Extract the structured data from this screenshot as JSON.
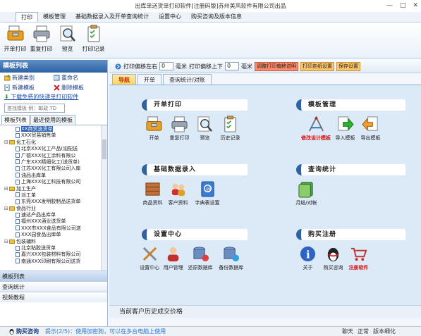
{
  "window": {
    "title": "出库单送货单打印软件[注册码版]苏州美风软件有限公司出品",
    "controls": [
      "—",
      "□",
      "✕"
    ]
  },
  "menu": {
    "tabs": [
      "打印",
      "模板管理",
      "基础数据录入及开单查询统计",
      "设置中心",
      "购买咨询及版本信息"
    ],
    "active": 0
  },
  "ribbon": {
    "buttons": [
      {
        "label": "开单打印",
        "icon": "print-toolbox-icon"
      },
      {
        "label": "重复打印",
        "icon": "printer-icon"
      },
      {
        "label": "预览",
        "icon": "magnifier-icon"
      },
      {
        "label": "打印记录",
        "icon": "clipboard-icon"
      }
    ]
  },
  "left_panel": {
    "title": "模板列表",
    "actions": [
      {
        "label": "新建类别",
        "icon": "add-category-icon"
      },
      {
        "label": "重命名",
        "icon": "rename-icon"
      },
      {
        "label": "新建模板",
        "icon": "new-template-icon"
      },
      {
        "label": "删除模板",
        "icon": "delete-icon"
      }
    ],
    "download_link": "下载免费的快递单打印软件",
    "search_placeholder": "查找模板 例：邮政 TD",
    "tabs": [
      "模板列表",
      "最近使用的模板"
    ],
    "tree": [
      {
        "level": 2,
        "type": "doc",
        "text": "XX商贸送货单",
        "selected": true
      },
      {
        "level": 2,
        "type": "doc",
        "text": "XXX贸易销售单"
      },
      {
        "level": 1,
        "type": "folder",
        "text": "化工石化",
        "toggle": "⊟"
      },
      {
        "level": 2,
        "type": "doc",
        "text": "北京XXX化工产品(油配送"
      },
      {
        "level": 2,
        "type": "doc",
        "text": "广德XXX化工涂料有限公"
      },
      {
        "level": 2,
        "type": "doc",
        "text": "广东XXX精细化工(送货单)"
      },
      {
        "level": 2,
        "type": "doc",
        "text": "江苏XXX化工有限公司入库"
      },
      {
        "level": 2,
        "type": "doc",
        "text": "油品出库单"
      },
      {
        "level": 2,
        "type": "doc",
        "text": "上海XXX化工科技有限公司"
      },
      {
        "level": 1,
        "type": "folder",
        "text": "加工生产",
        "toggle": "⊟"
      },
      {
        "level": 2,
        "type": "doc",
        "text": "派工单"
      },
      {
        "level": 2,
        "type": "doc",
        "text": "东莞XXX发明胶制品送货单"
      },
      {
        "level": 1,
        "type": "folder",
        "text": "食品行业",
        "toggle": "⊟"
      },
      {
        "level": 2,
        "type": "doc",
        "text": "速达产品出库单"
      },
      {
        "level": 2,
        "type": "doc",
        "text": "福州XXX酒业送货单"
      },
      {
        "level": 2,
        "type": "doc",
        "text": "XXX市XXX食品有限公司送"
      },
      {
        "level": 2,
        "type": "doc",
        "text": "XXX园食品出库单"
      },
      {
        "level": 1,
        "type": "folder",
        "text": "包装辅料",
        "toggle": "⊟"
      },
      {
        "level": 2,
        "type": "doc",
        "text": "北京粘胶送货单"
      },
      {
        "level": 2,
        "type": "doc",
        "text": "嘉兴XXX包装材料有限公司"
      },
      {
        "level": 2,
        "type": "doc",
        "text": "南通XXX印刷有限公司送货"
      }
    ],
    "sections": [
      "模板列表",
      "查询统计",
      "视频教程"
    ]
  },
  "print_toolbar": {
    "label_lr": "打印偏移左右",
    "value_lr": "0",
    "unit_lr": "毫米",
    "label_ud": "打印偏移上下",
    "value_ud": "0",
    "unit_ud": "毫米",
    "btn_help": "调整打印偏移说明",
    "btn_paper": "打印走纸设置",
    "btn_save": "保存设置"
  },
  "main_tabs": [
    "导航",
    "开单",
    "查询统计/对账"
  ],
  "sections": {
    "print": {
      "title": "开单打印",
      "items": [
        {
          "label": "开单",
          "icon": "toolbox-print-icon"
        },
        {
          "label": "重复打印",
          "icon": "printer-icon"
        },
        {
          "label": "预览",
          "icon": "magnifier-icon"
        },
        {
          "label": "历史记录",
          "icon": "clipboard-icon"
        }
      ]
    },
    "template": {
      "title": "模板管理",
      "items": [
        {
          "label": "修改设计模板",
          "icon": "design-tools-icon",
          "red": true
        },
        {
          "label": "导入模板",
          "icon": "import-arrow-icon"
        },
        {
          "label": "导出模板",
          "icon": "export-arrow-icon"
        }
      ]
    },
    "basic": {
      "title": "基础数据录入",
      "items": [
        {
          "label": "商品资料",
          "icon": "product-boxes-icon"
        },
        {
          "label": "客户资料",
          "icon": "customers-icon"
        },
        {
          "label": "字典表设置",
          "icon": "dictionary-book-icon"
        }
      ]
    },
    "query": {
      "title": "查询统计",
      "items": [
        {
          "label": "月结/对帐",
          "icon": "monthly-stats-icon"
        }
      ]
    },
    "settings": {
      "title": "设置中心",
      "items": [
        {
          "label": "设置中心",
          "icon": "tools-icon"
        },
        {
          "label": "用户管理",
          "icon": "user-manage-icon"
        },
        {
          "label": "还原数据库",
          "icon": "restore-db-icon"
        },
        {
          "label": "备份数据库",
          "icon": "backup-db-icon"
        }
      ]
    },
    "purchase": {
      "title": "购买注册",
      "items": [
        {
          "label": "关于",
          "icon": "info-icon"
        },
        {
          "label": "购买咨询",
          "icon": "qq-penguin-icon"
        },
        {
          "label": "注册软件",
          "icon": "cart-icon",
          "red": true
        }
      ]
    }
  },
  "history_bar": "当前客户历史成交价格",
  "status": {
    "buy": "购买咨询",
    "tip": "提示(2/5)：使用加密狗，可以在多台电脑上使用",
    "right": [
      "聊天",
      "正常",
      "版本细化"
    ]
  },
  "colors": {
    "accent": "#2e62a4",
    "canvas": "#dce9f7",
    "highlight": "#ffd45c",
    "alert": "#d01010"
  }
}
